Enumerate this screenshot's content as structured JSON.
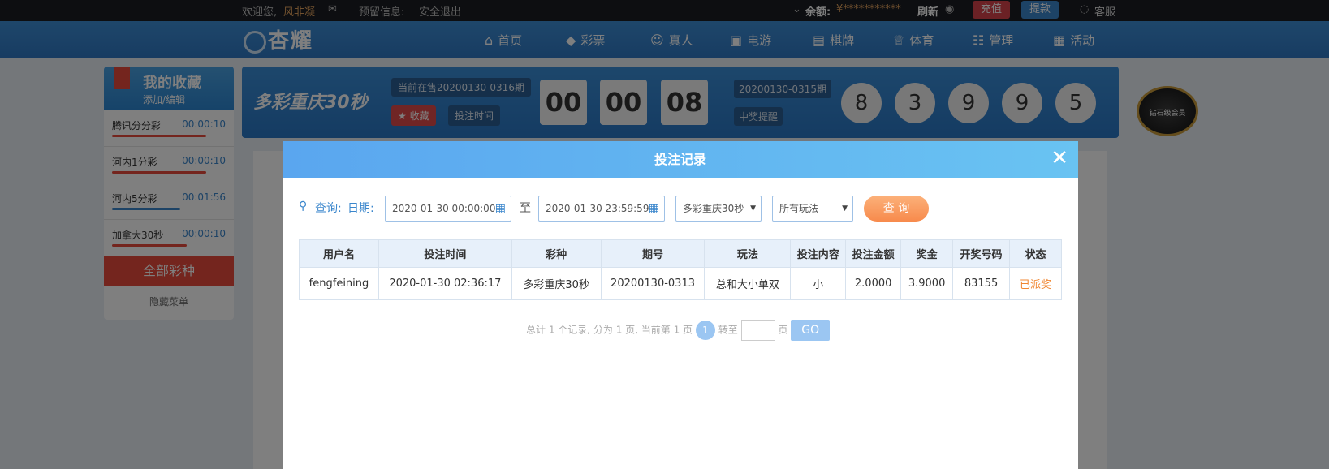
{
  "topbar": {
    "welcome": "欢迎您,",
    "username": "风非凝",
    "reserve_label": "预留信息:",
    "logout": "安全退出",
    "balance_label": "余额:",
    "balance_value": "¥***********",
    "refresh": "刷新",
    "recharge": "充值",
    "withdraw": "提款",
    "service": "客服"
  },
  "nav": {
    "logo": "杏耀",
    "items": [
      {
        "icon": "home-icon",
        "label": "首页"
      },
      {
        "icon": "lottery-icon",
        "label": "彩票"
      },
      {
        "icon": "live-icon",
        "label": "真人"
      },
      {
        "icon": "slot-icon",
        "label": "电游"
      },
      {
        "icon": "card-icon",
        "label": "棋牌"
      },
      {
        "icon": "trophy-icon",
        "label": "体育"
      },
      {
        "icon": "manage-icon",
        "label": "管理"
      },
      {
        "icon": "gift-icon",
        "label": "活动"
      }
    ]
  },
  "favorites": {
    "title": "我的收藏",
    "edit": "添加/编辑",
    "items": [
      {
        "name": "腾讯分分彩",
        "time": "00:00:10",
        "bar_color": "#e84a3c",
        "bar_fill": 0.8
      },
      {
        "name": "河内1分彩",
        "time": "00:00:10",
        "bar_color": "#e84a3c",
        "bar_fill": 0.8
      },
      {
        "name": "河内5分彩",
        "time": "00:01:56",
        "bar_color": "#3a86cc",
        "bar_fill": 0.58
      },
      {
        "name": "加拿大30秒",
        "time": "00:00:10",
        "bar_color": "#e84a3c",
        "bar_fill": 0.63
      }
    ],
    "all_label": "全部彩种",
    "hide_label": "隐藏菜单"
  },
  "game": {
    "logo": "多彩重庆30秒",
    "current_issue": "当前在售20200130-0316期",
    "collect": "收藏",
    "bet_time": "投注时间",
    "countdown": [
      "00",
      "00",
      "08"
    ],
    "prev_issue": "20200130-0315期",
    "win_remind": "中奖提醒",
    "balls": [
      "8",
      "3",
      "9",
      "9",
      "5"
    ],
    "badge": "钻石级会员"
  },
  "modal": {
    "title": "投注记录",
    "query_label": "查询:",
    "date_label": "日期:",
    "start_date": "2020-01-30 00:00:00",
    "to": "至",
    "end_date": "2020-01-30 23:59:59",
    "lottery_select": "多彩重庆30秒",
    "play_select": "所有玩法",
    "query_button": "查 询",
    "table": {
      "headers": [
        "用户名",
        "投注时间",
        "彩种",
        "期号",
        "玩法",
        "投注内容",
        "投注金额",
        "奖金",
        "开奖号码",
        "状态"
      ],
      "rows": [
        [
          "fengfeining",
          "2020-01-30 02:36:17",
          "多彩重庆30秒",
          "20200130-0313",
          "总和大小单双",
          "小",
          "2.0000",
          "3.9000",
          "83155",
          "已派奖"
        ]
      ]
    },
    "pager": {
      "summary": "总计 1 个记录, 分为 1 页, 当前第 1 页",
      "current": "1",
      "goto": "转至",
      "page_unit": "页",
      "go": "GO"
    }
  }
}
